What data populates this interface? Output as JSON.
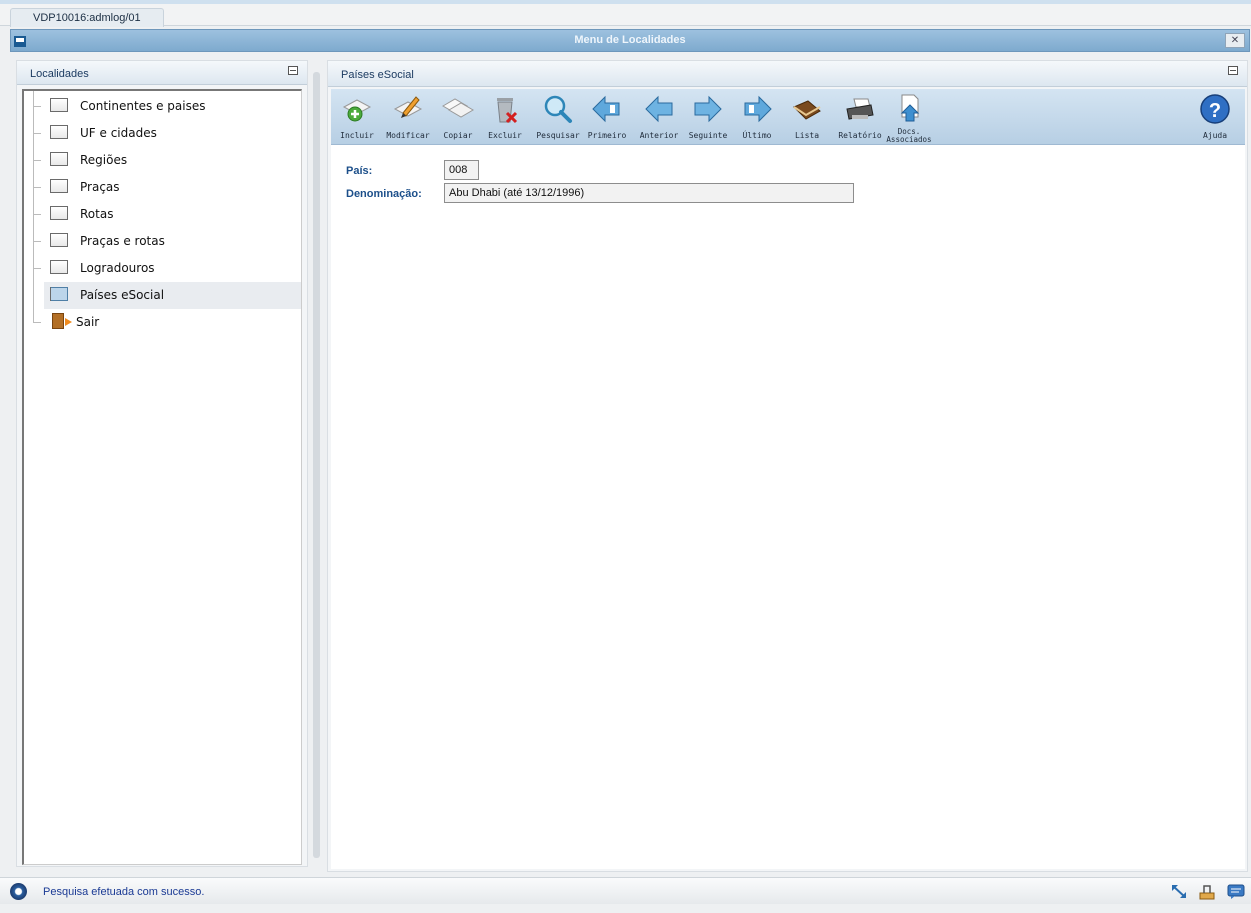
{
  "tab": {
    "label": "VDP10016:admlog/01"
  },
  "window": {
    "title": "Menu de Localidades",
    "close_label": "✕"
  },
  "left_panel": {
    "title": "Localidades",
    "items": [
      {
        "label": "Continentes e paises"
      },
      {
        "label": "UF e cidades"
      },
      {
        "label": "Regiões"
      },
      {
        "label": "Praças"
      },
      {
        "label": "Rotas"
      },
      {
        "label": "Praças e rotas"
      },
      {
        "label": "Logradouros"
      },
      {
        "label": "Países eSocial",
        "selected": true
      }
    ],
    "exit_label": "Sair"
  },
  "right_panel": {
    "title": "Países eSocial"
  },
  "toolbar": {
    "incluir": "Incluir",
    "modificar": "Modificar",
    "copiar": "Copiar",
    "excluir": "Excluir",
    "pesquisar": "Pesquisar",
    "primeiro": "Primeiro",
    "anterior": "Anterior",
    "seguinte": "Seguinte",
    "ultimo": "Último",
    "lista": "Lista",
    "relatorio": "Relatório",
    "docs_line1": "Docs.",
    "docs_line2": "Associados",
    "ajuda": "Ajuda"
  },
  "form": {
    "pais_label": "País:",
    "pais_value": "008",
    "denominacao_label": "Denominação:",
    "denominacao_value": "Abu Dhabi (até 13/12/1996)"
  },
  "status": {
    "message": "Pesquisa efetuada com sucesso."
  },
  "colors": {
    "accent": "#7eaace",
    "status_text": "#1a3a94",
    "label_blue": "#1c4f8a"
  }
}
